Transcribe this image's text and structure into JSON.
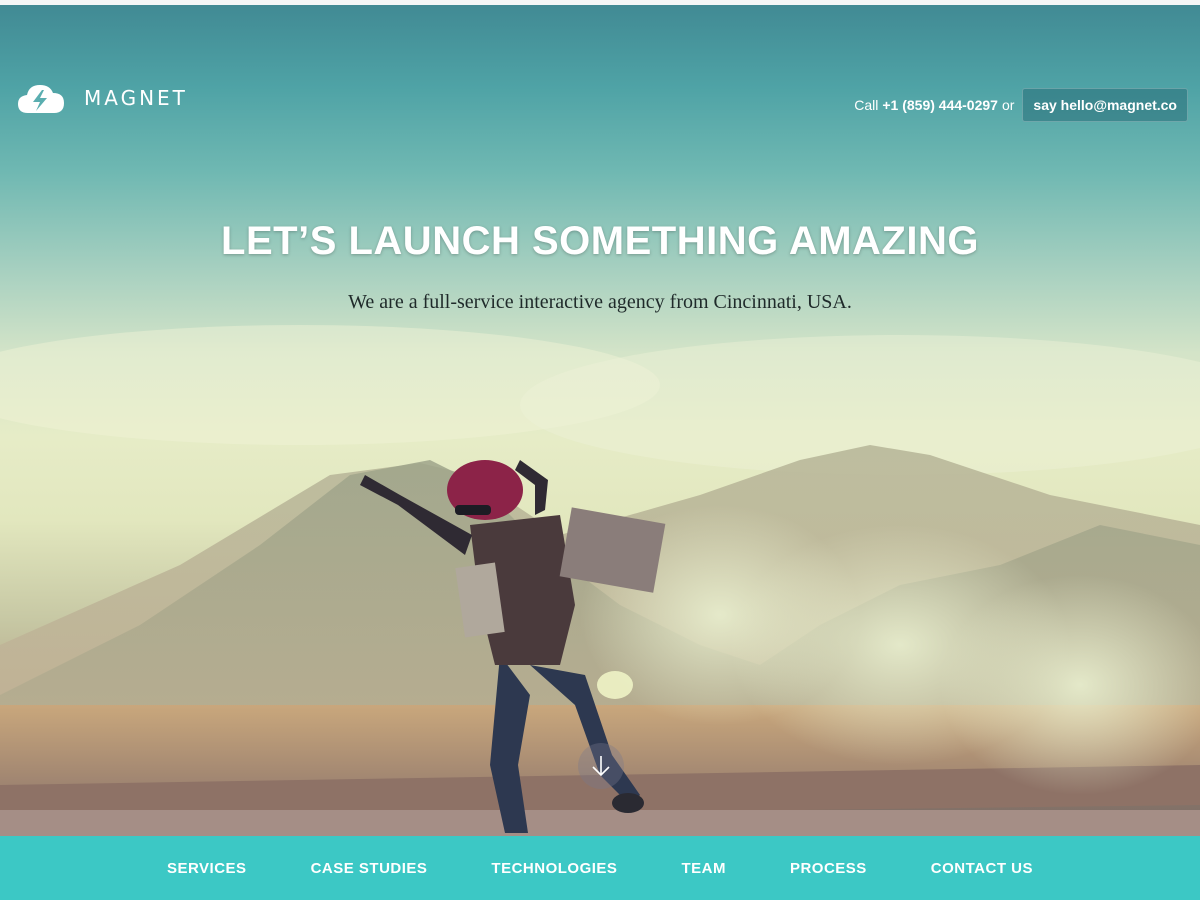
{
  "brand": {
    "name": "MAGNET",
    "logo_icon": "cloud-lightning-icon"
  },
  "header": {
    "call_prefix": "Call",
    "phone": "+1 (859) 444-0297",
    "call_suffix": "or",
    "email_button_label": "say hello@magnet.co"
  },
  "hero": {
    "headline": "LET’S LAUNCH SOMETHING AMAZING",
    "subheadline": "We are a full-service interactive agency from Cincinnati, USA.",
    "scroll_icon": "arrow-down-icon"
  },
  "nav": {
    "items": [
      {
        "label": "SERVICES"
      },
      {
        "label": "CASE STUDIES"
      },
      {
        "label": "TECHNOLOGIES"
      },
      {
        "label": "TEAM"
      },
      {
        "label": "PROCESS"
      },
      {
        "label": "CONTACT US"
      }
    ]
  },
  "colors": {
    "nav_background": "#3cc8c5",
    "sky_top": "#418a94",
    "text_light": "#ffffff",
    "text_dark": "#1f2a2a"
  }
}
